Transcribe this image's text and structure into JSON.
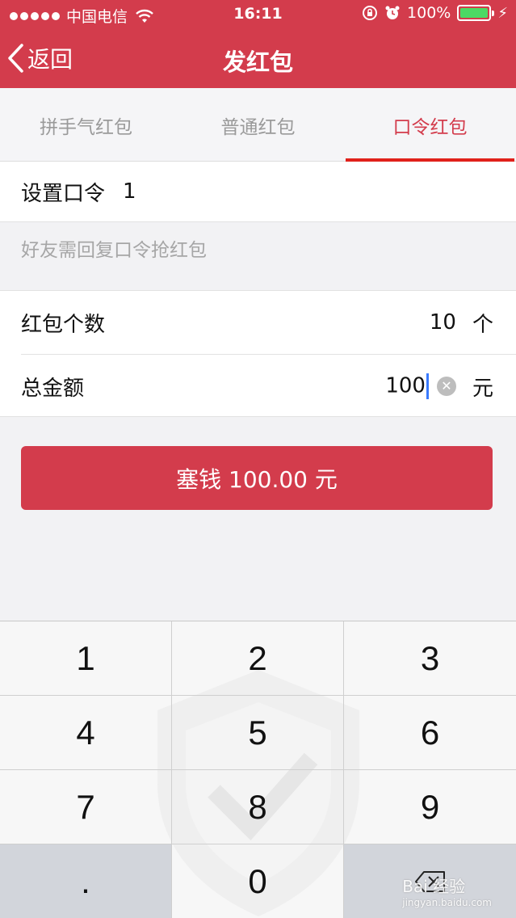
{
  "status_bar": {
    "carrier": "中国电信",
    "time": "16:11",
    "battery": "100%",
    "battery_level": 1.0
  },
  "nav": {
    "back_label": "返回",
    "title": "发红包"
  },
  "tabs": [
    {
      "label": "拼手气红包",
      "active": false
    },
    {
      "label": "普通红包",
      "active": false
    },
    {
      "label": "口令红包",
      "active": true
    }
  ],
  "form": {
    "keyword_label": "设置口令",
    "keyword_value": "1",
    "hint": "好友需回复口令抢红包",
    "count_label": "红包个数",
    "count_value": "10",
    "count_unit": "个",
    "amount_label": "总金额",
    "amount_value": "100",
    "amount_unit": "元"
  },
  "submit_label": "塞钱 100.00 元",
  "keypad": {
    "keys": [
      "1",
      "2",
      "3",
      "4",
      "5",
      "6",
      "7",
      "8",
      "9",
      ".",
      "0"
    ]
  },
  "watermark": {
    "text": "Bai 经验",
    "url": "jingyan.baidu.com"
  },
  "colors": {
    "brand": "#d33c4c",
    "tab_underline": "#e0211b",
    "caret": "#3a7bfd"
  }
}
